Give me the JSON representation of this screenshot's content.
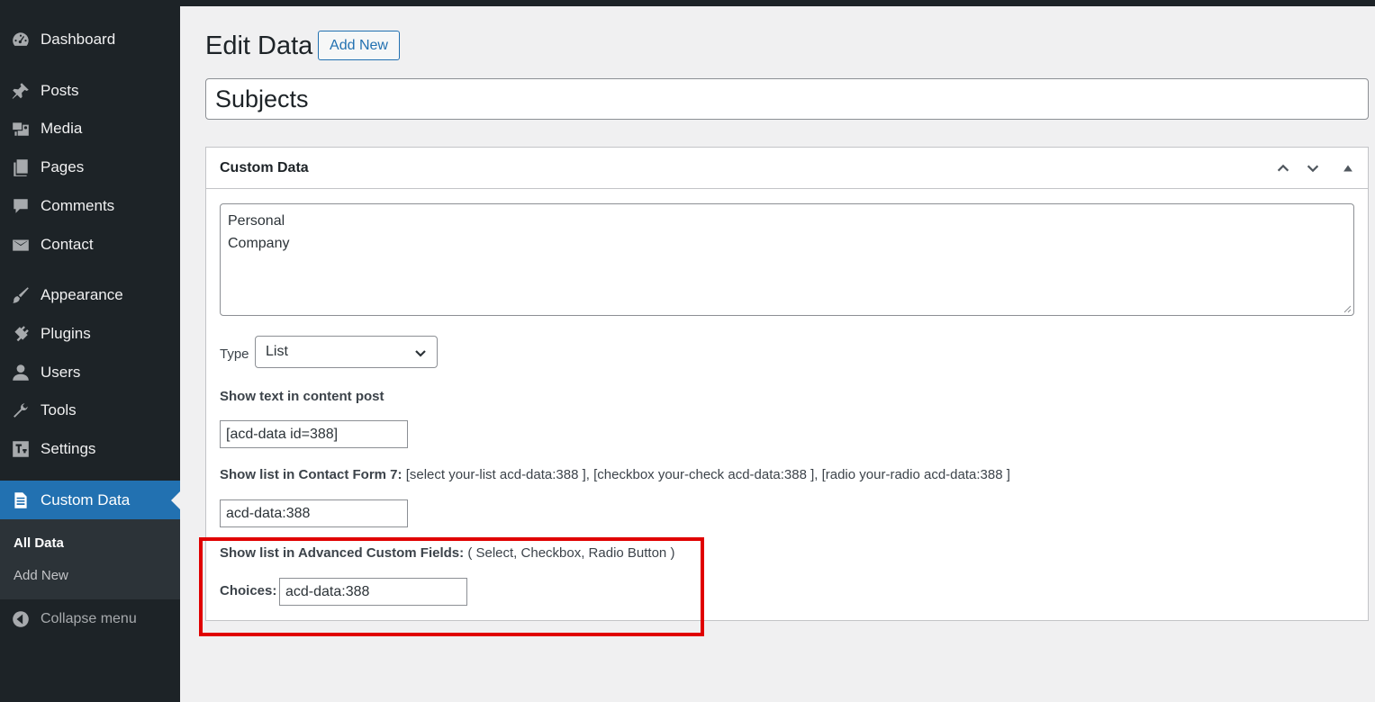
{
  "sidebar": {
    "items": [
      {
        "label": "Dashboard",
        "icon": "dashboard-icon"
      },
      {
        "label": "Posts",
        "icon": "pin-icon"
      },
      {
        "label": "Media",
        "icon": "media-icon"
      },
      {
        "label": "Pages",
        "icon": "pages-icon"
      },
      {
        "label": "Comments",
        "icon": "comments-icon"
      },
      {
        "label": "Contact",
        "icon": "envelope-icon"
      },
      {
        "label": "Appearance",
        "icon": "brush-icon"
      },
      {
        "label": "Plugins",
        "icon": "plug-icon"
      },
      {
        "label": "Users",
        "icon": "user-icon"
      },
      {
        "label": "Tools",
        "icon": "wrench-icon"
      },
      {
        "label": "Settings",
        "icon": "settings-icon"
      },
      {
        "label": "Custom Data",
        "icon": "document-icon",
        "current": true
      }
    ],
    "submenu": [
      {
        "label": "All Data",
        "active": true
      },
      {
        "label": "Add New",
        "active": false
      }
    ],
    "collapse_label": "Collapse menu"
  },
  "page": {
    "title": "Edit Data",
    "add_new_label": "Add New",
    "post_title_value": "Subjects"
  },
  "metabox": {
    "title": "Custom Data",
    "textarea_lines": [
      "Personal",
      "Company"
    ],
    "type_label": "Type",
    "type_value": "List",
    "show_text_label": "Show text in content post",
    "show_text_value": "[acd-data id=388]",
    "cf7_label": "Show list in Contact Form 7:",
    "cf7_hint": "[select your-list acd-data:388 ], [checkbox your-check acd-data:388 ], [radio your-radio acd-data:388 ]",
    "cf7_value": "acd-data:388",
    "acf_label": "Show list in Advanced Custom Fields:",
    "acf_hint": "( Select, Checkbox, Radio Button )",
    "choices_label": "Choices:",
    "choices_value": "acd-data:388"
  },
  "colors": {
    "sidebar_bg": "#1d2327",
    "accent": "#2271b1",
    "highlight": "#e00000"
  }
}
